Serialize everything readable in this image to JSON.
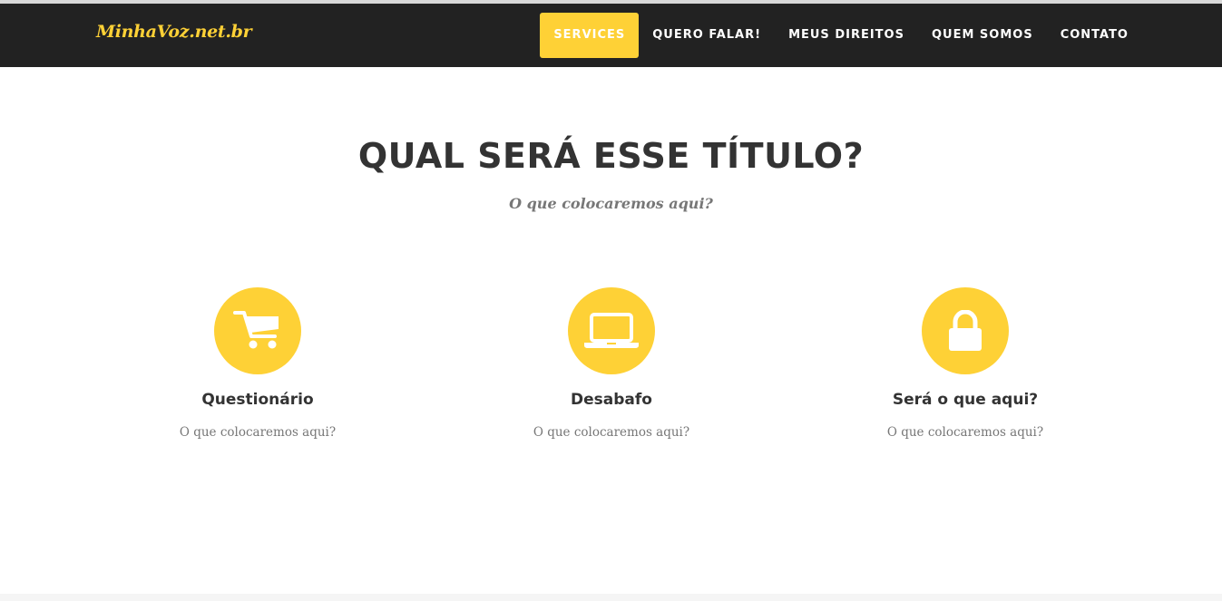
{
  "brand": {
    "name": "MinhaVoz.net.br"
  },
  "nav": {
    "items": [
      {
        "label": "SERVICES"
      },
      {
        "label": "QUERO FALAR!"
      },
      {
        "label": "MEUS DIREITOS"
      },
      {
        "label": "QUEM SOMOS"
      },
      {
        "label": "CONTATO"
      }
    ],
    "active_index": 0
  },
  "services_section": {
    "heading": "QUAL SERÁ ESSE TÍTULO?",
    "subheading": "O que colocaremos aqui?",
    "items": [
      {
        "icon": "shopping-cart-icon",
        "title": "Questionário",
        "text": "O que colocaremos aqui?"
      },
      {
        "icon": "laptop-icon",
        "title": "Desabafo",
        "text": "O que colocaremos aqui?"
      },
      {
        "icon": "lock-icon",
        "title": "Será o que aqui?",
        "text": "O que colocaremos aqui?"
      }
    ]
  },
  "colors": {
    "accent": "#fed136",
    "navbar": "#222222",
    "heading": "#333333",
    "muted": "#777777"
  }
}
